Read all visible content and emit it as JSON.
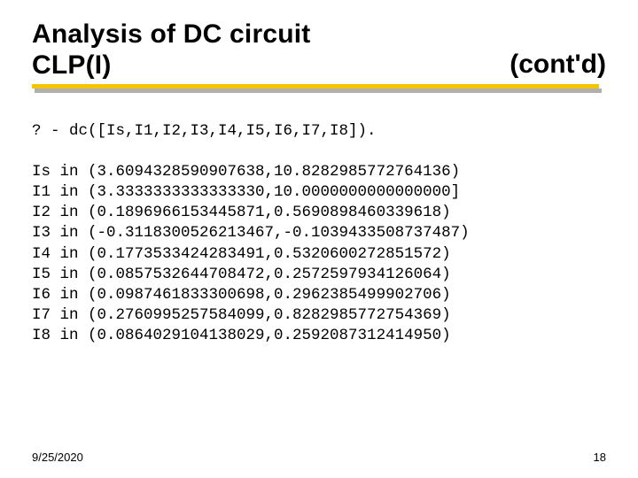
{
  "title": {
    "left": "Analysis of DC circuit\nCLP(I)",
    "right": "(cont'd)"
  },
  "query": "? - dc([Is,I1,I2,I3,I4,I5,I6,I7,I8]).",
  "results": [
    "Is in (3.6094328590907638,10.8282985772764136)",
    "I1 in (3.3333333333333330,10.0000000000000000]",
    "I2 in (0.1896966153445871,0.5690898460339618)",
    "I3 in (-0.3118300526213467,-0.1039433508737487)",
    "I4 in (0.1773533424283491,0.5320600272851572)",
    "I5 in (0.0857532644708472,0.2572597934126064)",
    "I6 in (0.0987461833300698,0.2962385499902706)",
    "I7 in (0.2760995257584099,0.8282985772754369)",
    "I8 in (0.0864029104138029,0.2592087312414950)"
  ],
  "footer": {
    "date": "9/25/2020",
    "page": "18"
  }
}
